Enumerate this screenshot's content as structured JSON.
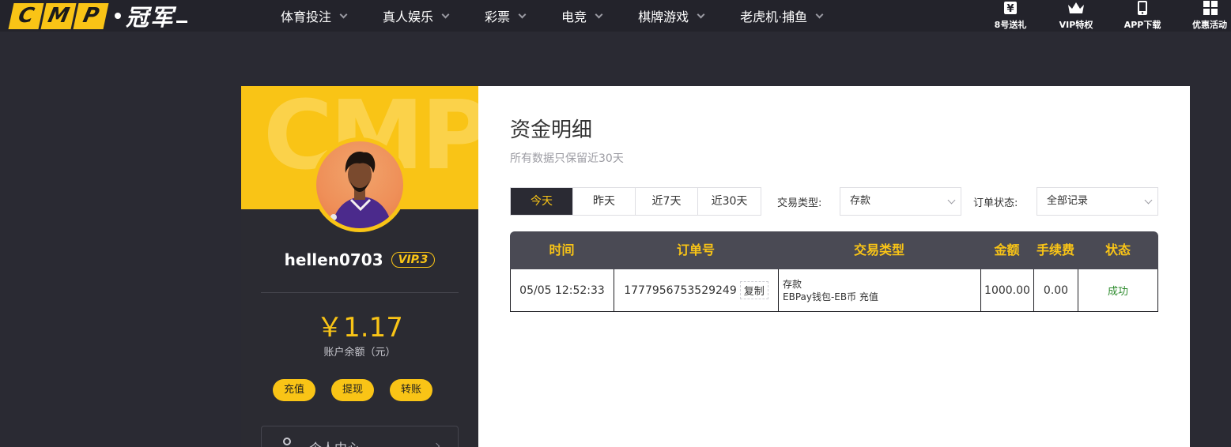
{
  "header": {
    "logo": {
      "cmp_letters": [
        "C",
        "M",
        "P"
      ],
      "cn_text": "冠军"
    },
    "nav": [
      {
        "label": "体育投注"
      },
      {
        "label": "真人娱乐"
      },
      {
        "label": "彩票"
      },
      {
        "label": "电竞"
      },
      {
        "label": "棋牌游戏"
      },
      {
        "label": "老虎机·捕鱼"
      }
    ],
    "quick_links": [
      {
        "label": "8号送礼",
        "icon": "yen-gift-icon"
      },
      {
        "label": "VIP特权",
        "icon": "crown-icon"
      },
      {
        "label": "APP下载",
        "icon": "phone-icon"
      },
      {
        "label": "优惠活动",
        "icon": "grid-icon"
      }
    ]
  },
  "profile": {
    "banner_watermark": "CMP",
    "username": "hellen0703",
    "vip_level": "VIP.3",
    "balance": "￥1.17",
    "balance_label": "账户余额（元）",
    "actions": [
      {
        "label": "充值"
      },
      {
        "label": "提现"
      },
      {
        "label": "转账"
      }
    ],
    "center_link": "个人中心"
  },
  "main": {
    "title": "资金明细",
    "subtitle": "所有数据只保留近30天",
    "date_tabs": [
      {
        "label": "今天",
        "active": true
      },
      {
        "label": "昨天",
        "active": false
      },
      {
        "label": "近7天",
        "active": false
      },
      {
        "label": "近30天",
        "active": false
      }
    ],
    "filters": {
      "type_label": "交易类型:",
      "type_value": "存款",
      "status_label": "订单状态:",
      "status_value": "全部记录"
    },
    "table": {
      "headers": [
        "时间",
        "订单号",
        "交易类型",
        "金额",
        "手续费",
        "状态"
      ],
      "rows": [
        {
          "time": "05/05 12:52:33",
          "order_no": "1777956753529249",
          "copy_label": "复制",
          "type_main": "存款",
          "type_sub": "EBPay钱包-EB币 充值",
          "amount": "1000.00",
          "fee": "0.00",
          "status": "成功"
        }
      ]
    }
  },
  "colors": {
    "accent": "#f9c416",
    "dark_bg": "#2a2a33",
    "success": "#2b8a2b"
  }
}
